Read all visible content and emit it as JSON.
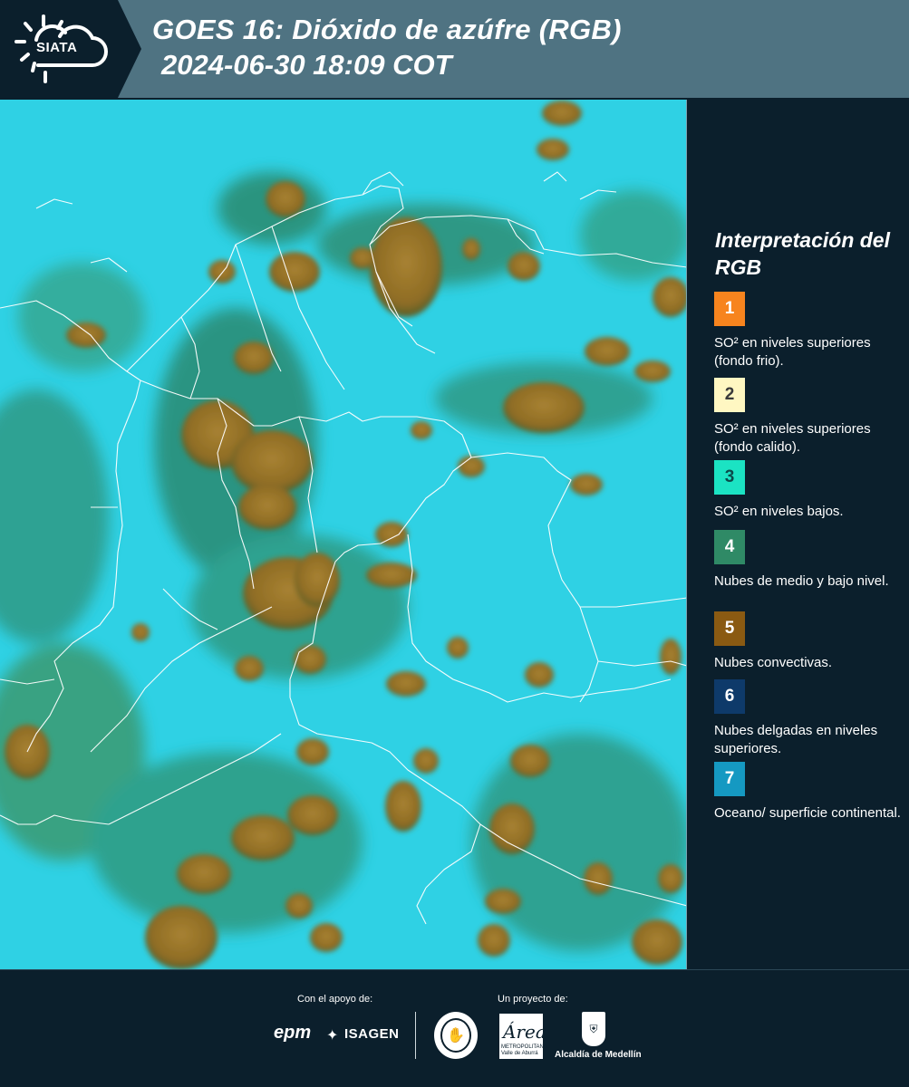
{
  "header": {
    "logo_text": "SIATA",
    "title": "GOES 16: Dióxido de azúfre (RGB)",
    "subtitle": "2024-06-30 18:09 COT"
  },
  "map": {
    "ocean_color": "#2fd1e4",
    "convective_color": "#9b7a2a",
    "low_cloud_color": "#2f8a6a",
    "border_color": "#ffffff"
  },
  "legend": {
    "title": "Interpretación del RGB",
    "items": [
      {
        "number": "1",
        "label": "SO² en niveles superiores (fondo frio).",
        "color": "#f7841e",
        "text_color": "#ffffff"
      },
      {
        "number": "2",
        "label": "SO² en niveles superiores (fondo calido).",
        "color": "#fff7c2",
        "text_color": "#3a3a3a"
      },
      {
        "number": "3",
        "label": "SO² en niveles bajos.",
        "color": "#1be3c3",
        "text_color": "#0b4a4a"
      },
      {
        "number": "4",
        "label": "Nubes de medio y bajo nivel.",
        "color": "#2f8a66",
        "text_color": "#ffffff"
      },
      {
        "number": "5",
        "label": "Nubes convectivas.",
        "color": "#8a5a12",
        "text_color": "#ffffff"
      },
      {
        "number": "6",
        "label": "Nubes delgadas en niveles superiores.",
        "color": "#0e3a6a",
        "text_color": "#ffffff"
      },
      {
        "number": "7",
        "label": "Oceano/ superficie continental.",
        "color": "#1599c2",
        "text_color": "#ffffff"
      }
    ]
  },
  "footer": {
    "support_label": "Con el apoyo de:",
    "project_label": "Un proyecto de:",
    "sponsor_1": "epm",
    "sponsor_2": "ISAGEN",
    "area_word": "Área",
    "area_sub": "METROPOLITANA Valle de Aburrá",
    "alcaldia": "Alcaldía de Medellín"
  }
}
